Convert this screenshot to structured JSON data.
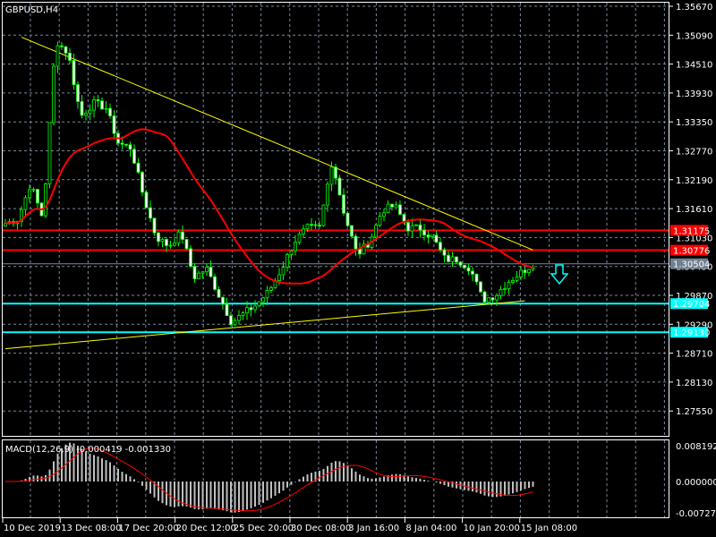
{
  "chart_title": "GBPUSD,H4",
  "macd_label": "MACD(12,26,9) -0.000419 -0.001330",
  "colors": {
    "bull": "#00ff00",
    "ma": "#ff0000",
    "trend": "#ffff00",
    "support": "#00ffff",
    "grid": "#778899",
    "axis": "#ffffff"
  },
  "chart_data": {
    "type": "candlestick",
    "symbol": "GBPUSD",
    "timeframe": "H4",
    "price_ticks": [
      "1.35670",
      "1.35090",
      "1.34510",
      "1.33930",
      "1.33350",
      "1.32770",
      "1.32190",
      "1.31610",
      "1.31030",
      "1.30450",
      "1.29870",
      "1.29290",
      "1.28710",
      "1.28130",
      "1.27550"
    ],
    "ylim": [
      1.2723,
      1.3575
    ],
    "time_labels": [
      "10 Dec 2019",
      "13 Dec 08:00",
      "17 Dec 20:00",
      "20 Dec 12:00",
      "25 Dec 20:00",
      "30 Dec 08:00",
      "3 Jan 16:00",
      "8 Jan 04:00",
      "10 Jan 20:00",
      "15 Jan 08:00"
    ],
    "candle_count": 132,
    "close_path": [
      1.3131,
      1.314,
      1.3211,
      1.314,
      1.3499,
      1.3472,
      1.3346,
      1.3373,
      1.3364,
      1.3292,
      1.3283,
      1.3185,
      1.3104,
      1.3086,
      1.3113,
      1.3023,
      1.3041,
      1.2987,
      1.2933,
      1.2951,
      1.2969,
      1.2996,
      1.3041,
      1.3095,
      1.3122,
      1.3122,
      1.3256,
      1.3149,
      1.3068,
      1.3095,
      1.3158,
      1.3167,
      1.3122,
      1.3122,
      1.3104,
      1.3059,
      1.3059,
      1.3041,
      1.2978,
      1.2987,
      1.3014,
      1.3032,
      1.305
    ],
    "price_levels": [
      {
        "label": "1.31175",
        "value": 1.31175,
        "kind": "resistance",
        "color": "#ff0000"
      },
      {
        "label": "1.30776",
        "value": 1.30776,
        "kind": "resistance",
        "color": "#ff0000"
      },
      {
        "label": "1.30504",
        "value": 1.30504,
        "kind": "current",
        "color": "#708090"
      },
      {
        "label": "1.29704",
        "value": 1.29704,
        "kind": "support",
        "color": "#00ffff"
      },
      {
        "label": "1.29130",
        "value": 1.2913,
        "kind": "support",
        "color": "#00ffff"
      }
    ],
    "trendlines": [
      {
        "name": "descending",
        "from": [
          4,
          1.3505
        ],
        "to": [
          131,
          1.3078
        ]
      },
      {
        "name": "ascending",
        "from": [
          0,
          1.288
        ],
        "to": [
          129,
          1.2976
        ]
      }
    ],
    "macd": {
      "fast": 12,
      "slow": 26,
      "signal": 9,
      "value": -0.000419,
      "signal_value": -0.00133,
      "ticks": [
        "0.008192",
        "0.000000",
        "-0.007273"
      ]
    },
    "signal_arrow": "down"
  }
}
